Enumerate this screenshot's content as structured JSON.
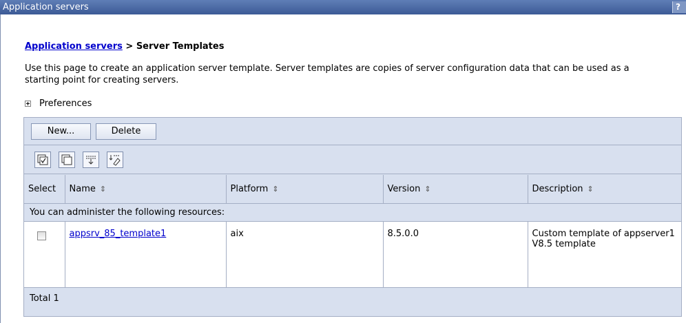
{
  "window": {
    "title": "Application servers",
    "help_label": "?"
  },
  "breadcrumb": {
    "link": "Application servers",
    "separator": " > ",
    "current": "Server Templates"
  },
  "description": "Use this page to create an application server template. Server templates are copies of server configuration data that can be used as a starting point for creating servers.",
  "preferences": {
    "label": "Preferences",
    "expand_icon": "plus-box-icon"
  },
  "toolbar": {
    "new_label": "New...",
    "delete_label": "Delete"
  },
  "icon_toolbar": [
    {
      "name": "select-all-icon"
    },
    {
      "name": "deselect-all-icon"
    },
    {
      "name": "show-filter-icon"
    },
    {
      "name": "clear-filter-icon"
    }
  ],
  "table": {
    "columns": [
      "Select",
      "Name",
      "Platform",
      "Version",
      "Description"
    ],
    "sort_icon": "sort-arrows-icon",
    "notice": "You can administer the following resources:",
    "rows": [
      {
        "name": "appsrv_85_template1",
        "platform": "aix",
        "version": "8.5.0.0",
        "description": "Custom template of appserver1 V8.5 template",
        "selected": false
      }
    ],
    "total_label": "Total 1"
  },
  "colors": {
    "title_bar": "#3c5a96",
    "panel_bg": "#d8e0ef",
    "link": "#0000cc"
  }
}
